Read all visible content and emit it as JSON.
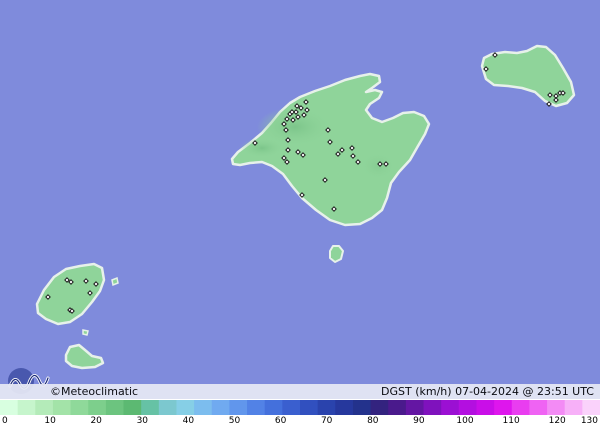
{
  "map": {
    "sea_color": "#7f8bdc",
    "land_color": "#8fd49a",
    "land_edge_color": "#e7f1ea",
    "marker_icon": "station-marker-icon",
    "station_count": 48
  },
  "brand": {
    "name": "©Meteoclimatic",
    "logo_icon": "meteoclimatic-logo-icon"
  },
  "product": {
    "label": "DGST (km/h)  07-04-2024 @ 23:51 UTC"
  },
  "scale": {
    "unit": "km/h",
    "ticks": [
      "0",
      "10",
      "20",
      "30",
      "40",
      "50",
      "60",
      "70",
      "80",
      "90",
      "100",
      "110",
      "120",
      "130"
    ],
    "colors": [
      "#d8ffe0",
      "#c6f5cc",
      "#b4ebb9",
      "#a3e3a8",
      "#8fd99a",
      "#7dcf8c",
      "#6cc47f",
      "#5cb972",
      "#66c2a5",
      "#7cc8cf",
      "#86cfe6",
      "#7cbdee",
      "#70aaf0",
      "#6196ec",
      "#5282e6",
      "#4470dc",
      "#3a5fcf",
      "#3150bf",
      "#2a43ad",
      "#26389d",
      "#23328c",
      "#33237f",
      "#4a1a8c",
      "#6416a3",
      "#7f12bd",
      "#9b10d3",
      "#b30fe0",
      "#c90ee8",
      "#de16ed",
      "#e93df0",
      "#ef63f3",
      "#f38bf5",
      "#f7b0f8",
      "#fad2fb"
    ]
  }
}
